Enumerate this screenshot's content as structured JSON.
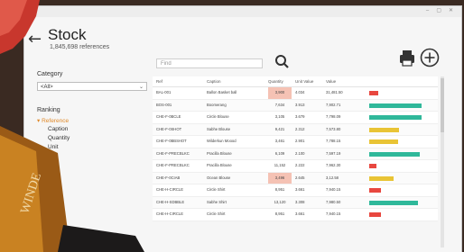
{
  "window": {
    "controls": "‒ ▢ ✕"
  },
  "header": {
    "title": "Stock",
    "subtitle": "1,845,698 references"
  },
  "filters": {
    "category_label": "Category",
    "category_value": "<All>",
    "ranking_label": "Ranking",
    "ranking_items": [
      "Reference",
      "Caption",
      "Quantity",
      "Unit"
    ]
  },
  "search": {
    "placeholder": "Find"
  },
  "colors": {
    "green": "#2fb89a",
    "yellow": "#e9c435",
    "red": "#e8473f",
    "accent": "#e08a2b"
  },
  "table": {
    "headers": [
      "Ref",
      "Caption",
      "Quantity",
      "Unit Value",
      "Value"
    ],
    "rows": [
      {
        "ref": "BAL-001",
        "caption": "Ballon Basket ball",
        "qty": "3,900",
        "unit": "4.034",
        "value": "31,481.50",
        "hl": true,
        "bar": "red",
        "level": 0.15
      },
      {
        "ref": "BOS-001",
        "caption": "Boomerang",
        "qty": "7,634",
        "unit": "3.913",
        "value": "7,902.71",
        "hl": false,
        "bar": "green",
        "level": 0.9
      },
      {
        "ref": "CHE-F-0BCLE",
        "caption": "Circle Blouse",
        "qty": "3,105",
        "unit": "3.679",
        "value": "7,798.09",
        "hl": false,
        "bar": "green",
        "level": 0.9
      },
      {
        "ref": "CHE-F-0SHOT",
        "caption": "Sabhe Blouse",
        "qty": "9,421",
        "unit": "2.312",
        "value": "7,573.80",
        "hl": false,
        "bar": "yellow",
        "level": 0.52
      },
      {
        "ref": "CHE-F-0BBSHOT",
        "caption": "Wilderkun Moood",
        "qty": "3,461",
        "unit": "2.901",
        "value": "7,788.15",
        "hl": false,
        "bar": "yellow",
        "level": 0.5
      },
      {
        "ref": "CHE-F-PRECBLKC",
        "caption": "Pracilla Blouse",
        "qty": "6,109",
        "unit": "2.100",
        "value": "7,597.19",
        "hl": false,
        "bar": "green",
        "level": 0.88
      },
      {
        "ref": "CHE-F-PRECBLKC",
        "caption": "Pracilla Blouse",
        "qty": "11,152",
        "unit": "2.222",
        "value": "7,962.30",
        "hl": false,
        "bar": "red",
        "level": 0.12
      },
      {
        "ref": "CHE-F-0CIAB",
        "caption": "Ocean Blouse",
        "qty": "3,496",
        "unit": "2.645",
        "value": "3,12.58",
        "hl": true,
        "bar": "yellow",
        "level": 0.42
      },
      {
        "ref": "CHE-H-CIRCLE",
        "caption": "Circle Shirt",
        "qty": "8,951",
        "unit": "3.661",
        "value": "7,940.15",
        "hl": false,
        "bar": "red",
        "level": 0.2
      },
      {
        "ref": "CHE-H-SDBBLE",
        "caption": "Sabhe Shirt",
        "qty": "13,120",
        "unit": "3.308",
        "value": "7,980.50",
        "hl": false,
        "bar": "green",
        "level": 0.85
      },
      {
        "ref": "CHE-H-CIRCLE",
        "caption": "Circle Shirt",
        "qty": "8,951",
        "unit": "3.661",
        "value": "7,940.15",
        "hl": false,
        "bar": "red",
        "level": 0.2
      }
    ]
  }
}
